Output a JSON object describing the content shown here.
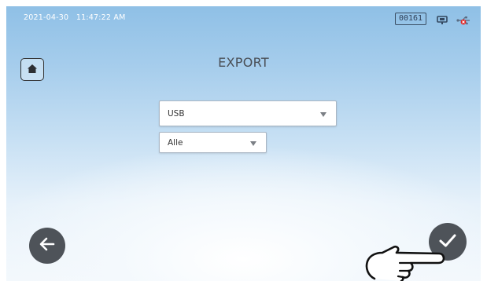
{
  "status_bar": {
    "date": "2021-04-30",
    "time": "11:47:22 AM",
    "counter": "00161",
    "icons": [
      "device-icon",
      "usb-disconnected-icon"
    ]
  },
  "header": {
    "title": "EXPORT"
  },
  "export_target": {
    "selected": "USB"
  },
  "export_scope": {
    "selected": "Alle"
  },
  "navigation": {
    "home_icon": "home-icon",
    "back_icon": "arrow-left-icon",
    "confirm_icon": "checkmark-icon"
  },
  "colors": {
    "button_dark": "#4e5359",
    "usb_error": "#e02020",
    "sky_top": "#8fc0e6"
  }
}
